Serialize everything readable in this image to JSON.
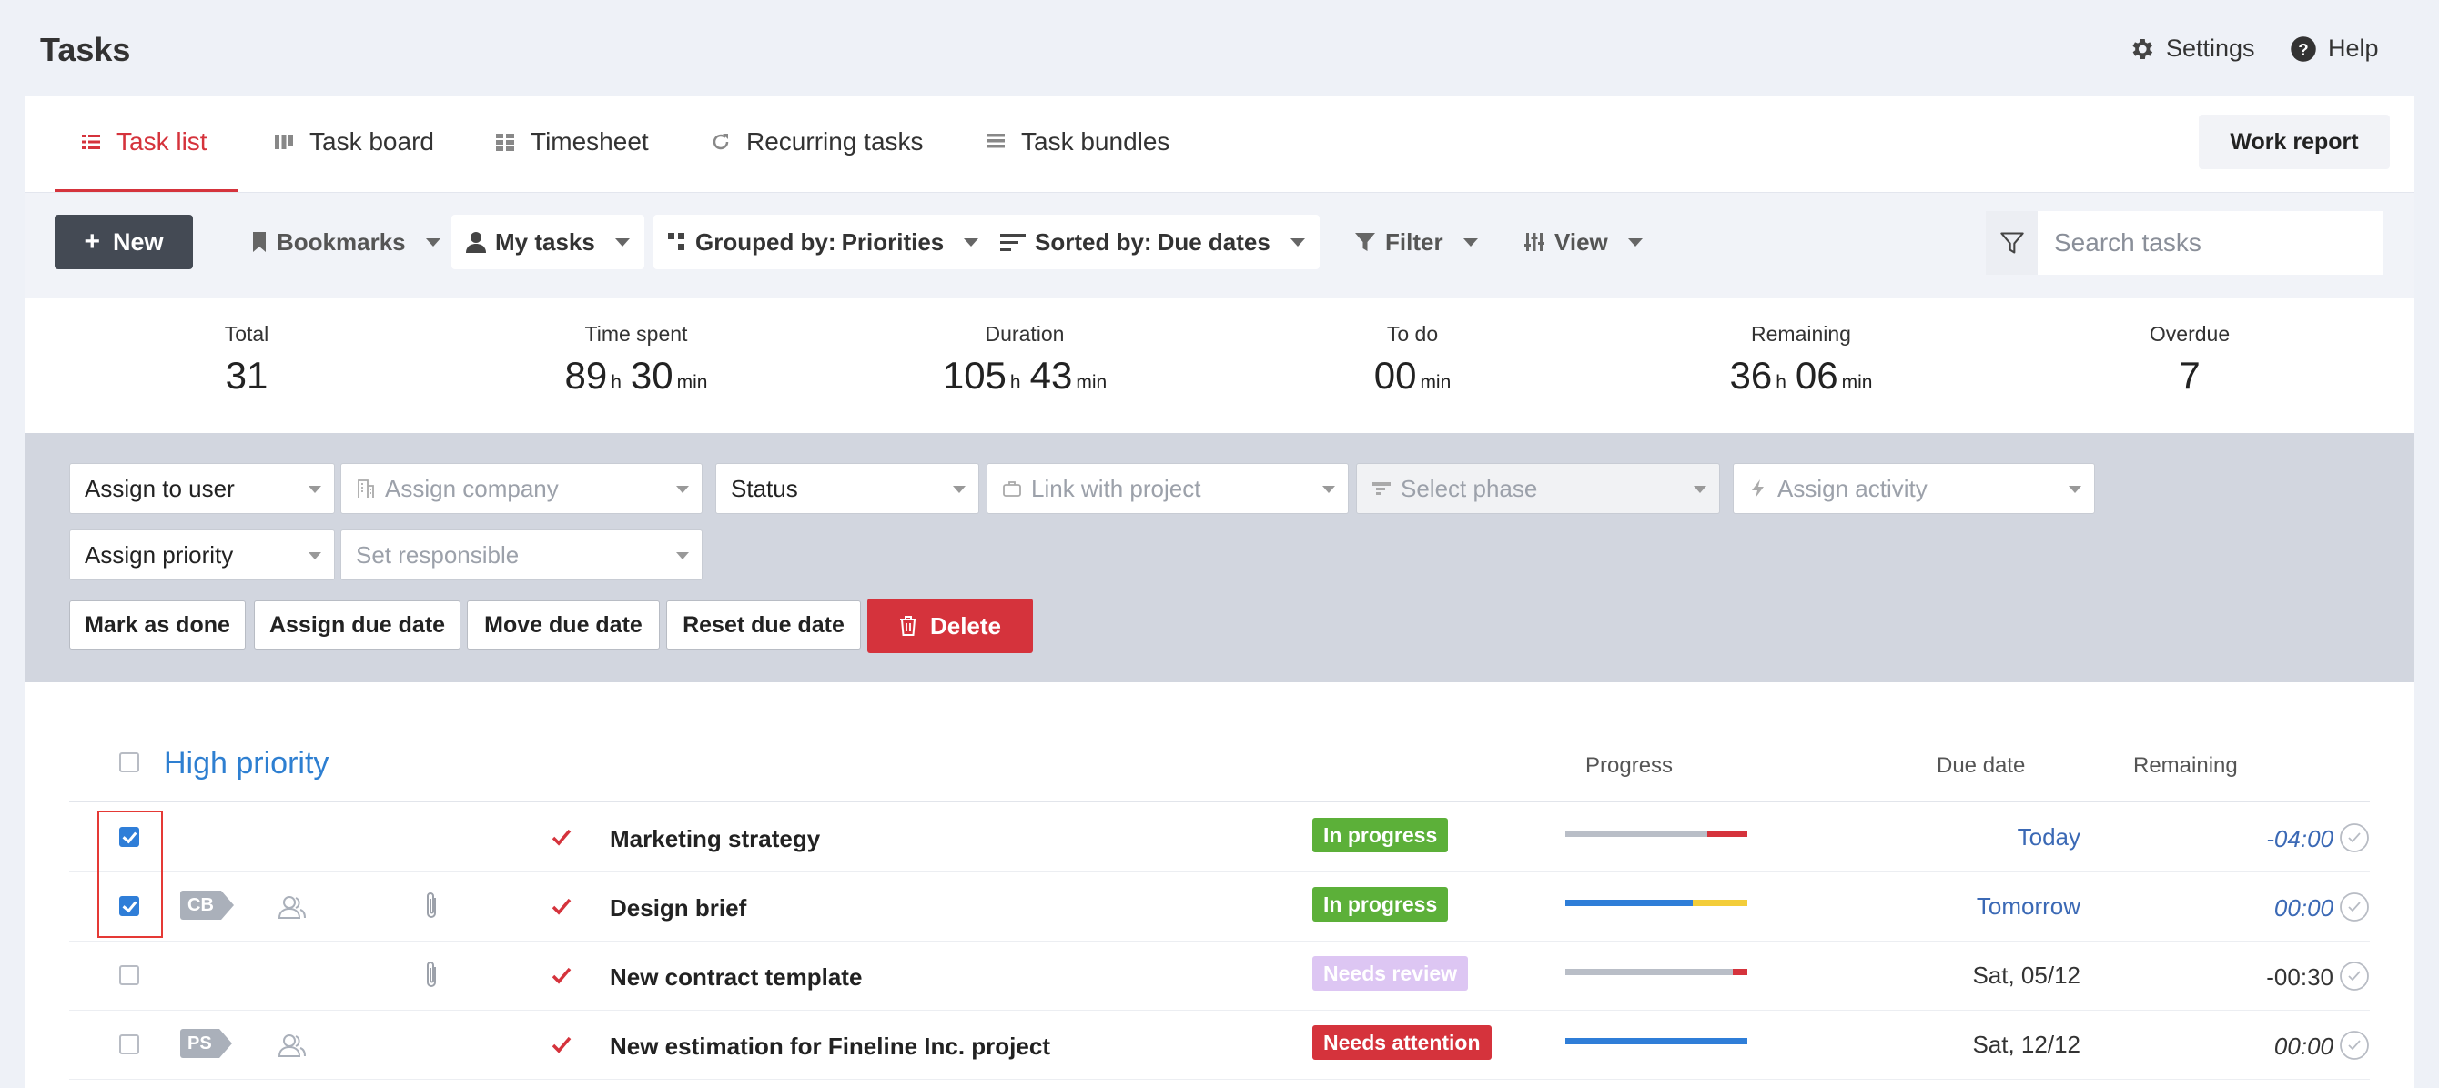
{
  "header": {
    "title": "Tasks",
    "settings_label": "Settings",
    "help_label": "Help"
  },
  "tabs": [
    {
      "label": "Task list",
      "icon": "list-icon",
      "active": true
    },
    {
      "label": "Task board",
      "icon": "board-icon",
      "active": false
    },
    {
      "label": "Timesheet",
      "icon": "grid-icon",
      "active": false
    },
    {
      "label": "Recurring tasks",
      "icon": "refresh-icon",
      "active": false
    },
    {
      "label": "Task bundles",
      "icon": "stack-icon",
      "active": false
    }
  ],
  "work_report_label": "Work report",
  "toolbar": {
    "new_label": "New",
    "bookmarks_label": "Bookmarks",
    "my_tasks_label": "My tasks",
    "grouped_prefix": "Grouped by:",
    "grouped_value": "Priorities",
    "sorted_prefix": "Sorted by:",
    "sorted_value": "Due dates",
    "filter_label": "Filter",
    "view_label": "View",
    "search_placeholder": "Search tasks"
  },
  "stats": [
    {
      "label": "Total",
      "value": "31"
    },
    {
      "label": "Time spent",
      "h": "89",
      "h_unit": "h",
      "m": "30",
      "m_unit": "min"
    },
    {
      "label": "Duration",
      "h": "105",
      "h_unit": "h",
      "m": "43",
      "m_unit": "min"
    },
    {
      "label": "To do",
      "m": "00",
      "m_unit": "min"
    },
    {
      "label": "Remaining",
      "h": "36",
      "h_unit": "h",
      "m": "06",
      "m_unit": "min"
    },
    {
      "label": "Overdue",
      "value": "7"
    }
  ],
  "bulk": {
    "assign_user": "Assign to user",
    "assign_company": "Assign company",
    "status": "Status",
    "link_project": "Link with project",
    "select_phase": "Select phase",
    "assign_activity": "Assign activity",
    "assign_priority": "Assign priority",
    "set_responsible": "Set responsible",
    "mark_done": "Mark as done",
    "assign_due": "Assign due date",
    "move_due": "Move due date",
    "reset_due": "Reset due date",
    "delete": "Delete"
  },
  "table": {
    "group_title": "High priority",
    "col_progress": "Progress",
    "col_due": "Due date",
    "col_remaining": "Remaining",
    "rows": [
      {
        "name": "Marketing strategy",
        "status": "In progress",
        "status_color": "#5cb039",
        "progress": 0.78,
        "progress_color": "#d5333c",
        "due": "Today",
        "due_blue": true,
        "remaining": "-04:00",
        "rem_style": "blue-it",
        "checked": true,
        "initials": "",
        "people": false,
        "clip": false
      },
      {
        "name": "Design brief",
        "status": "In progress",
        "status_color": "#5cb039",
        "progress": 0.7,
        "progress_color": "#f3cd3a",
        "progress_base": "#2f7ed8",
        "due": "Tomorrow",
        "due_blue": true,
        "remaining": "00:00",
        "rem_style": "blue-it",
        "checked": true,
        "initials": "CB",
        "people": true,
        "clip": true
      },
      {
        "name": "New contract template",
        "status": "Needs review",
        "status_color": "#ddc6f3",
        "progress": 0.92,
        "progress_color": "#d5333c",
        "due": "Sat, 05/12",
        "due_blue": false,
        "remaining": "-00:30",
        "rem_style": "plain",
        "checked": false,
        "initials": "",
        "people": false,
        "clip": true
      },
      {
        "name": "New estimation for Fineline Inc. project",
        "status": "Needs attention",
        "status_color": "#d5333c",
        "progress": 1.0,
        "progress_color": "#2f7ed8",
        "progress_base": "#2f7ed8",
        "due": "Sat, 12/12",
        "due_blue": false,
        "remaining": "00:00",
        "rem_style": "it",
        "checked": false,
        "initials": "PS",
        "people": true,
        "clip": false
      }
    ]
  }
}
